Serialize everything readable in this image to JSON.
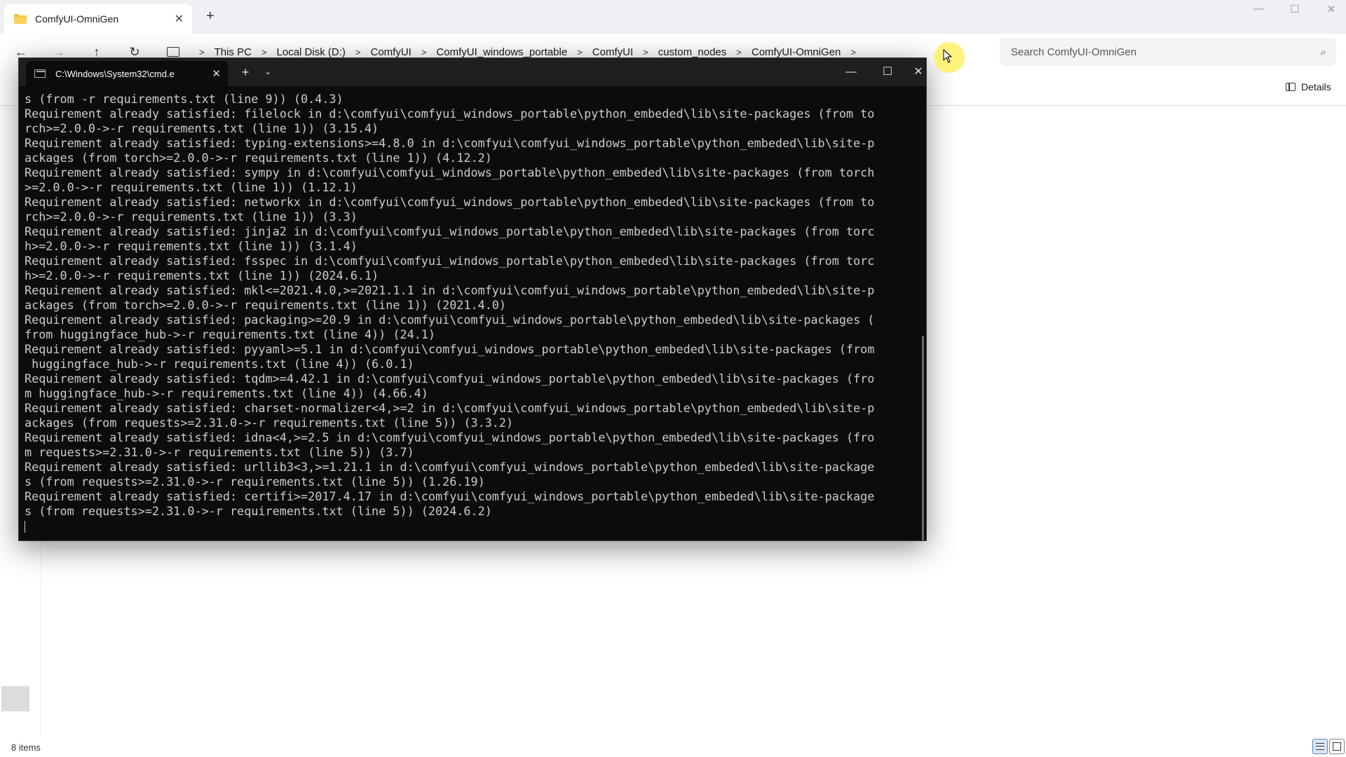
{
  "explorer": {
    "tab_title": "ComfyUI-OmniGen",
    "breadcrumbs": [
      "This PC",
      "Local Disk (D:)",
      "ComfyUI",
      "ComfyUI_windows_portable",
      "ComfyUI",
      "custom_nodes",
      "ComfyUI-OmniGen"
    ],
    "search_placeholder": "Search ComfyUI-OmniGen",
    "details_label": "Details",
    "status_items": "8 items"
  },
  "terminal": {
    "tab_title": "C:\\Windows\\System32\\cmd.e",
    "lines": [
      "s (from -r requirements.txt (line 9)) (0.4.3)",
      "Requirement already satisfied: filelock in d:\\comfyui\\comfyui_windows_portable\\python_embeded\\lib\\site-packages (from to",
      "rch>=2.0.0->-r requirements.txt (line 1)) (3.15.4)",
      "Requirement already satisfied: typing-extensions>=4.8.0 in d:\\comfyui\\comfyui_windows_portable\\python_embeded\\lib\\site-p",
      "ackages (from torch>=2.0.0->-r requirements.txt (line 1)) (4.12.2)",
      "Requirement already satisfied: sympy in d:\\comfyui\\comfyui_windows_portable\\python_embeded\\lib\\site-packages (from torch",
      ">=2.0.0->-r requirements.txt (line 1)) (1.12.1)",
      "Requirement already satisfied: networkx in d:\\comfyui\\comfyui_windows_portable\\python_embeded\\lib\\site-packages (from to",
      "rch>=2.0.0->-r requirements.txt (line 1)) (3.3)",
      "Requirement already satisfied: jinja2 in d:\\comfyui\\comfyui_windows_portable\\python_embeded\\lib\\site-packages (from torc",
      "h>=2.0.0->-r requirements.txt (line 1)) (3.1.4)",
      "Requirement already satisfied: fsspec in d:\\comfyui\\comfyui_windows_portable\\python_embeded\\lib\\site-packages (from torc",
      "h>=2.0.0->-r requirements.txt (line 1)) (2024.6.1)",
      "Requirement already satisfied: mkl<=2021.4.0,>=2021.1.1 in d:\\comfyui\\comfyui_windows_portable\\python_embeded\\lib\\site-p",
      "ackages (from torch>=2.0.0->-r requirements.txt (line 1)) (2021.4.0)",
      "Requirement already satisfied: packaging>=20.9 in d:\\comfyui\\comfyui_windows_portable\\python_embeded\\lib\\site-packages (",
      "from huggingface_hub->-r requirements.txt (line 4)) (24.1)",
      "Requirement already satisfied: pyyaml>=5.1 in d:\\comfyui\\comfyui_windows_portable\\python_embeded\\lib\\site-packages (from",
      " huggingface_hub->-r requirements.txt (line 4)) (6.0.1)",
      "Requirement already satisfied: tqdm>=4.42.1 in d:\\comfyui\\comfyui_windows_portable\\python_embeded\\lib\\site-packages (fro",
      "m huggingface_hub->-r requirements.txt (line 4)) (4.66.4)",
      "Requirement already satisfied: charset-normalizer<4,>=2 in d:\\comfyui\\comfyui_windows_portable\\python_embeded\\lib\\site-p",
      "ackages (from requests>=2.31.0->-r requirements.txt (line 5)) (3.3.2)",
      "Requirement already satisfied: idna<4,>=2.5 in d:\\comfyui\\comfyui_windows_portable\\python_embeded\\lib\\site-packages (fro",
      "m requests>=2.31.0->-r requirements.txt (line 5)) (3.7)",
      "Requirement already satisfied: urllib3<3,>=1.21.1 in d:\\comfyui\\comfyui_windows_portable\\python_embeded\\lib\\site-package",
      "s (from requests>=2.31.0->-r requirements.txt (line 5)) (1.26.19)",
      "Requirement already satisfied: certifi>=2017.4.17 in d:\\comfyui\\comfyui_windows_portable\\python_embeded\\lib\\site-package",
      "s (from requests>=2.31.0->-r requirements.txt (line 5)) (2024.6.2)"
    ]
  },
  "colors": {
    "terminal_bg": "#0c0c0c",
    "terminal_text": "#cccccc",
    "explorer_bg": "#ffffff",
    "folder_yellow": "#f4c542",
    "cursor_highlight": "#fff05a"
  }
}
